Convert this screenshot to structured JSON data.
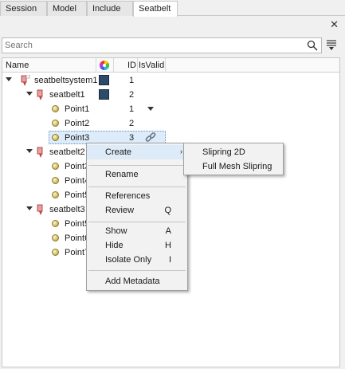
{
  "tabs": [
    {
      "label": "Session",
      "active": false
    },
    {
      "label": "Model",
      "active": false
    },
    {
      "label": "Include",
      "active": false
    },
    {
      "label": "Seatbelt",
      "active": true
    }
  ],
  "search": {
    "placeholder": "Search",
    "value": ""
  },
  "columns": {
    "name": "Name",
    "id": "ID",
    "is_valid": "IsValid"
  },
  "tree": [
    {
      "label": "seatbeltsystem1",
      "id": "1",
      "type": "system",
      "expanded": true
    },
    {
      "label": "seatbelt1",
      "id": "2",
      "type": "seatbelt",
      "expanded": true
    },
    {
      "label": "Point1",
      "id": "1",
      "type": "point"
    },
    {
      "label": "Point2",
      "id": "2",
      "type": "point"
    },
    {
      "label": "Point3",
      "id": "3",
      "type": "point",
      "selected": true
    },
    {
      "label": "seatbelt2",
      "id": "",
      "type": "seatbelt",
      "expanded": true
    },
    {
      "label": "Point3",
      "id": "",
      "type": "point"
    },
    {
      "label": "Point4",
      "id": "",
      "type": "point"
    },
    {
      "label": "Point5",
      "id": "",
      "type": "point"
    },
    {
      "label": "seatbelt3",
      "id": "",
      "type": "seatbelt",
      "expanded": true
    },
    {
      "label": "Point5",
      "id": "",
      "type": "point"
    },
    {
      "label": "Point6",
      "id": "",
      "type": "point"
    },
    {
      "label": "Point7",
      "id": "",
      "type": "point"
    }
  ],
  "context_menu": {
    "items": [
      {
        "label": "Create",
        "shortcut": "",
        "has_submenu": true
      },
      {
        "label": "Rename",
        "shortcut": ""
      },
      {
        "label": "References",
        "shortcut": ""
      },
      {
        "label": "Review",
        "shortcut": "Q"
      },
      {
        "label": "Show",
        "shortcut": "A"
      },
      {
        "label": "Hide",
        "shortcut": "H"
      },
      {
        "label": "Isolate Only",
        "shortcut": "I"
      },
      {
        "label": "Add Metadata",
        "shortcut": ""
      }
    ]
  },
  "submenu": {
    "items": [
      {
        "label": "Slipring 2D"
      },
      {
        "label": "Full Mesh Slipring"
      }
    ]
  },
  "colors": {
    "swatch": "#2c4a6a",
    "selection": "#dcecfa",
    "menu_highlight": "#ddeaf7"
  },
  "icons": {
    "close": "close-icon",
    "search": "search-icon",
    "filter": "filter-icon",
    "color_column": "color-wheel-icon",
    "link": "link-icon"
  }
}
